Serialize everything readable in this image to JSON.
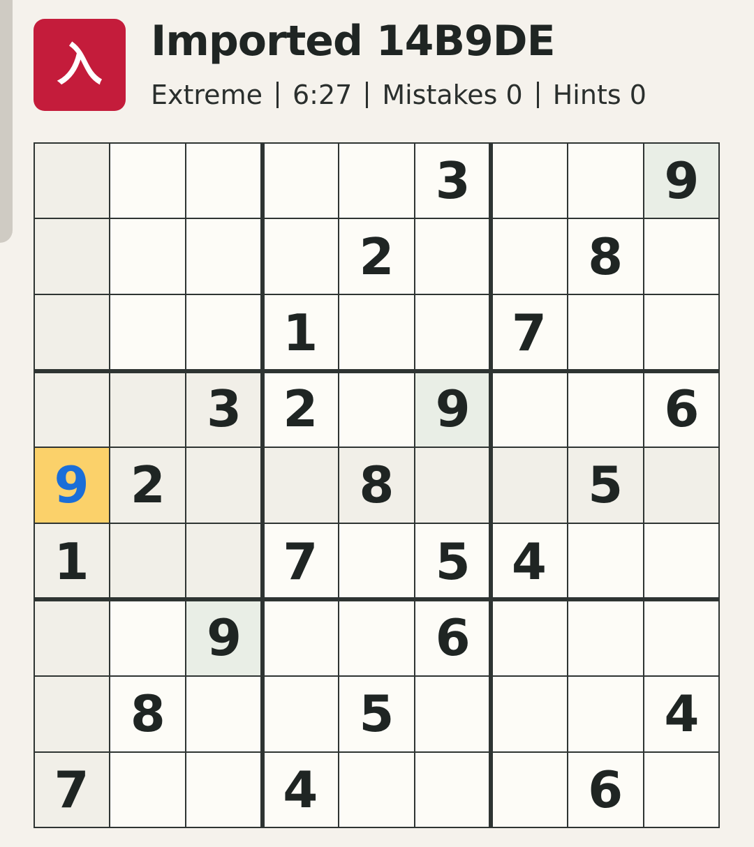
{
  "header": {
    "icon_glyph": "入",
    "icon_name": "app-logo-icon",
    "title": "Imported 14B9DE",
    "difficulty": "Extreme",
    "timer": "6:27",
    "mistakes": "Mistakes 0",
    "hints": "Hints 0"
  },
  "colors": {
    "brand": "#c41c3b",
    "selected_cell": "#fbd16a",
    "selected_digit": "#1a6ed8",
    "highlight": "#f1efe8",
    "same_digit": "#e9eee6",
    "cell_bg": "#fdfcf7",
    "grid_line": "#2e3432"
  },
  "board": {
    "grid": [
      [
        "",
        "",
        "",
        "",
        "",
        "3",
        "",
        "",
        "9"
      ],
      [
        "",
        "",
        "",
        "",
        "2",
        "",
        "",
        "8",
        ""
      ],
      [
        "",
        "",
        "",
        "1",
        "",
        "",
        "7",
        "",
        ""
      ],
      [
        "",
        "",
        "3",
        "2",
        "",
        "9",
        "",
        "",
        "6"
      ],
      [
        "9",
        "2",
        "",
        "",
        "8",
        "",
        "",
        "5",
        ""
      ],
      [
        "1",
        "",
        "",
        "7",
        "",
        "5",
        "4",
        "",
        ""
      ],
      [
        "",
        "",
        "9",
        "",
        "",
        "6",
        "",
        "",
        ""
      ],
      [
        "",
        "8",
        "",
        "",
        "5",
        "",
        "",
        "",
        "4"
      ],
      [
        "7",
        "",
        "",
        "4",
        "",
        "",
        "",
        "6",
        ""
      ]
    ],
    "selected": [
      4,
      0
    ]
  }
}
